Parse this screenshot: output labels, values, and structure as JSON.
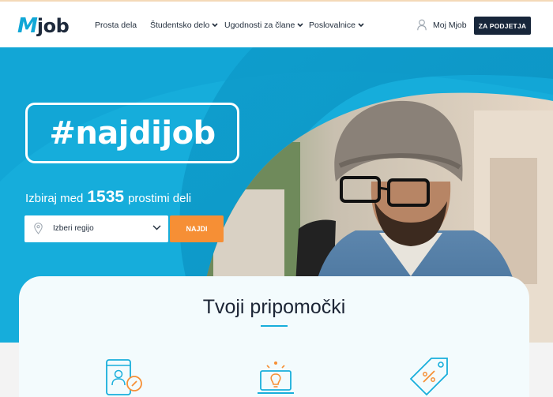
{
  "header": {
    "logo_m": "M",
    "logo_job": "job",
    "nav": [
      {
        "label": "Prosta dela",
        "has_dropdown": false
      },
      {
        "label": "Študentsko delo",
        "has_dropdown": true
      },
      {
        "label": "Ugodnosti za člane",
        "has_dropdown": true
      },
      {
        "label": "Poslovalnice",
        "has_dropdown": true
      }
    ],
    "user_link": "Moj Mjob",
    "cta_button": "ZA PODJETJA"
  },
  "hero": {
    "hashtag": "#najdijob",
    "tagline_before": "Izbiraj med",
    "job_count": "1535",
    "tagline_after": "prostimi deli",
    "region_select": {
      "selected": "Izberi regijo"
    },
    "search_button": "NAJDI"
  },
  "tools": {
    "title": "Tvoji pripomočki",
    "icons": [
      "tablet-profile-icon",
      "laptop-lightbulb-icon",
      "discount-tag-icon"
    ]
  },
  "colors": {
    "brand_blue": "#11a7d6",
    "navy": "#17263a",
    "orange": "#f68f35",
    "hero_bg": "#18b2dc"
  }
}
